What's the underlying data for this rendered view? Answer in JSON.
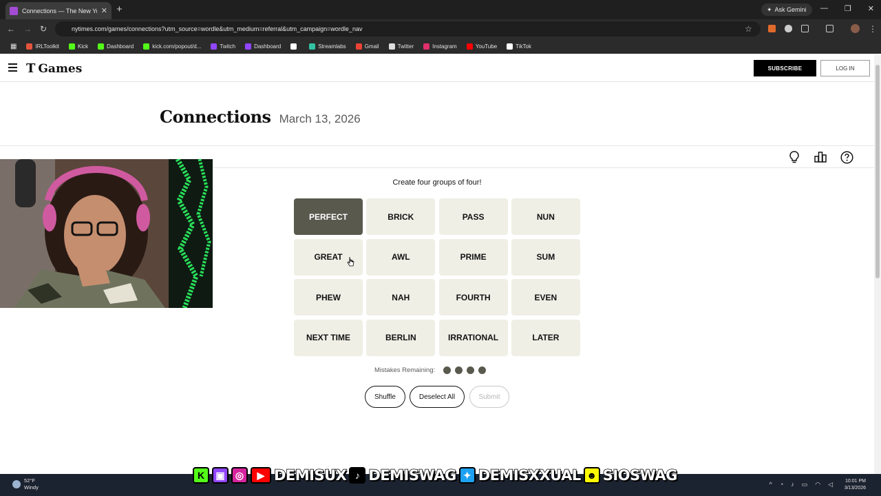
{
  "browser": {
    "tab_title": "Connections — The New York Times",
    "url": "nytimes.com/games/connections?utm_source=wordle&utm_medium=referral&utm_campaign=wordle_nav",
    "ask_gemini": "Ask Gemini",
    "bookmarks": [
      {
        "label": "IRLToolkit",
        "color": "#e5533d"
      },
      {
        "label": "Kick",
        "color": "#53fc18"
      },
      {
        "label": "Dashboard",
        "color": "#53fc18"
      },
      {
        "label": "kick.com/popout/d...",
        "color": "#53fc18"
      },
      {
        "label": "Twitch",
        "color": "#9146ff"
      },
      {
        "label": "Dashboard",
        "color": "#9146ff"
      },
      {
        "label": "",
        "color": "#ffffff"
      },
      {
        "label": "Streamlabs",
        "color": "#31c3a2"
      },
      {
        "label": "Gmail",
        "color": "#ea4335"
      },
      {
        "label": "Twitter",
        "color": "#dddddd"
      },
      {
        "label": "Instagram",
        "color": "#e1306c"
      },
      {
        "label": "YouTube",
        "color": "#ff0000"
      },
      {
        "label": "TikTok",
        "color": "#ffffff"
      }
    ]
  },
  "header": {
    "logo_t": "T",
    "logo_games": "Games",
    "subscribe": "SUBSCRIBE",
    "login": "LOG IN"
  },
  "page": {
    "title": "Connections",
    "date": "March 13, 2026",
    "instructions": "Create four groups of four!"
  },
  "tiles": [
    {
      "word": "PERFECT",
      "selected": true
    },
    {
      "word": "BRICK",
      "selected": false
    },
    {
      "word": "PASS",
      "selected": false
    },
    {
      "word": "NUN",
      "selected": false
    },
    {
      "word": "GREAT",
      "selected": false
    },
    {
      "word": "AWL",
      "selected": false
    },
    {
      "word": "PRIME",
      "selected": false
    },
    {
      "word": "SUM",
      "selected": false
    },
    {
      "word": "PHEW",
      "selected": false
    },
    {
      "word": "NAH",
      "selected": false
    },
    {
      "word": "FOURTH",
      "selected": false
    },
    {
      "word": "EVEN",
      "selected": false
    },
    {
      "word": "NEXT TIME",
      "selected": false
    },
    {
      "word": "BERLIN",
      "selected": false
    },
    {
      "word": "IRRATIONAL",
      "selected": false
    },
    {
      "word": "LATER",
      "selected": false
    }
  ],
  "mistakes": {
    "label": "Mistakes Remaining:",
    "remaining": 4
  },
  "actions": {
    "shuffle": "Shuffle",
    "deselect_all": "Deselect All",
    "submit": "Submit"
  },
  "taskbar": {
    "temp": "52°F",
    "condition": "Windy",
    "time": "10:01 PM",
    "date": "3/13/2026"
  },
  "stream_overlay": {
    "handles": [
      "DEMISUX",
      "DEMISWAG",
      "DEMISXXUAL",
      "SIOSWAG"
    ]
  },
  "colors": {
    "tile_bg": "#efefe6",
    "tile_selected": "#5a594e",
    "subscribe_bg": "#000000"
  }
}
